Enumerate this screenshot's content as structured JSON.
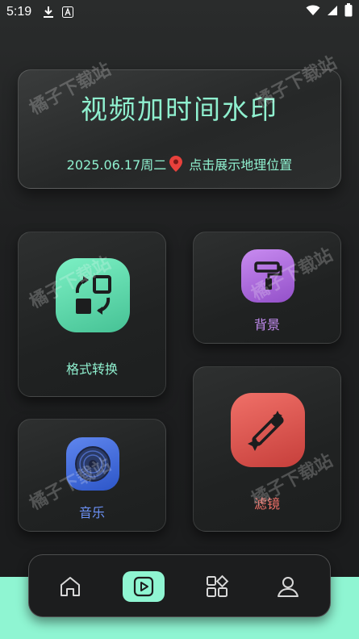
{
  "status_bar": {
    "time": "5:19",
    "icons_left": [
      "download-icon",
      "font-a-icon"
    ],
    "icons_right": [
      "wifi-icon",
      "signal-icon",
      "battery-icon"
    ]
  },
  "header": {
    "title": "视频加时间水印",
    "date": "2025.06.17周二",
    "location_label": "点击展示地理位置"
  },
  "features": {
    "format": {
      "label": "格式转换",
      "icon": "swap-shapes-icon"
    },
    "background": {
      "label": "背景",
      "icon": "paint-roller-icon"
    },
    "music": {
      "label": "音乐",
      "icon": "vinyl-disc-icon"
    },
    "filter": {
      "label": "滤镜",
      "icon": "magic-wand-icon"
    }
  },
  "watermark_text": "橘子下载站",
  "bottom_nav": {
    "items": [
      {
        "name": "home",
        "icon": "home-icon",
        "active": false
      },
      {
        "name": "video",
        "icon": "play-square-icon",
        "active": true
      },
      {
        "name": "apps",
        "icon": "apps-grid-icon",
        "active": false
      },
      {
        "name": "profile",
        "icon": "user-icon",
        "active": false
      }
    ]
  },
  "colors": {
    "accent": "#8ff0cf",
    "background_purple": "#c38cf1",
    "music_blue": "#6b90f4",
    "filter_red": "#f07068",
    "bottom_band": "#8ff5d2"
  }
}
